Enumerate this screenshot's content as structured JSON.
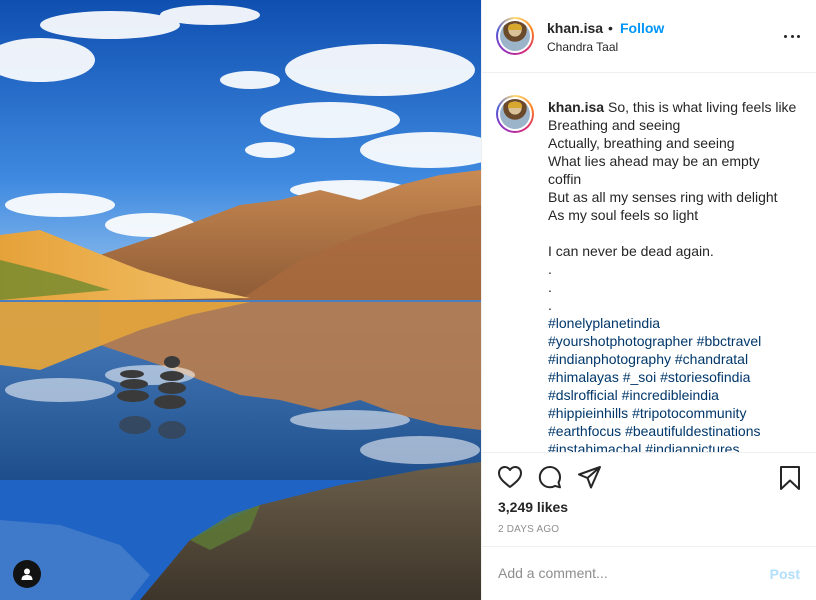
{
  "post": {
    "username": "khan.isa",
    "dot": "•",
    "follow_label": "Follow",
    "location": "Chandra Taal",
    "caption_lines": [
      "So, this is what living feels like",
      "Breathing and seeing",
      "Actually, breathing and seeing",
      "What lies ahead may be an empty",
      "coffin",
      "But as all my senses ring with delight",
      "As my soul feels so light",
      "",
      "I can never be dead again.",
      ".",
      ".",
      "."
    ],
    "hashtag_lines": [
      [
        "#lonelyplanetindia"
      ],
      [
        "#yourshotphotographer",
        "#bbctravel"
      ],
      [
        "#indianphotography",
        "#chandratal"
      ],
      [
        "#himalayas",
        "#_soi",
        "#storiesofindia"
      ],
      [
        "#dslrofficial",
        "#incredibleindia"
      ],
      [
        "#hippieinhills",
        "#tripotocommunity"
      ],
      [
        "#earthfocus",
        "#beautifuldestinations"
      ],
      [
        "#instahimachal",
        "#indianpictures"
      ]
    ],
    "likes": "3,249 likes",
    "timestamp": "2 DAYS AGO",
    "comment_placeholder": "Add a comment...",
    "post_label": "Post"
  },
  "icons": {
    "more": "more-options-icon",
    "like": "heart-icon",
    "comment": "comment-icon",
    "share": "share-icon",
    "save": "bookmark-icon",
    "tag": "user-tag-icon"
  },
  "colors": {
    "link_blue": "#0095f6",
    "hashtag": "#00376b",
    "muted": "#8e8e8e",
    "post_disabled": "#b2dffc"
  }
}
